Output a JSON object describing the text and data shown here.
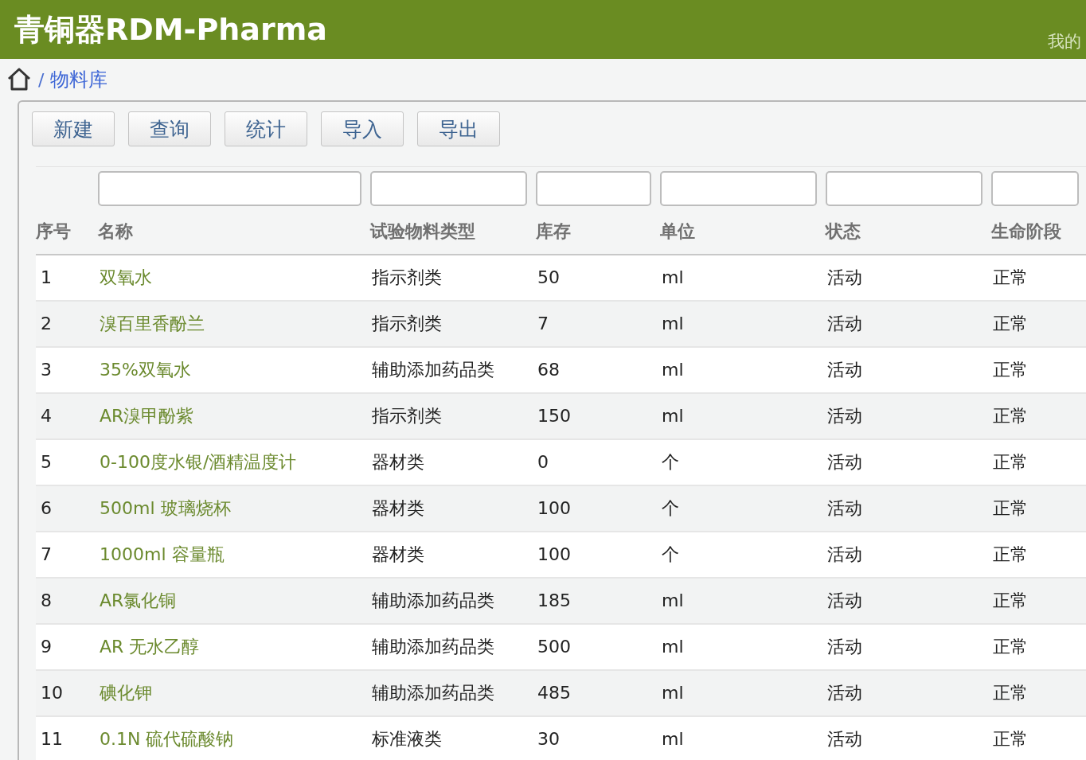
{
  "header": {
    "title": "青铜器RDM-Pharma",
    "user_menu": "我的"
  },
  "breadcrumb": {
    "separator": "/",
    "current": "物料库"
  },
  "toolbar": [
    "新建",
    "查询",
    "统计",
    "导入",
    "导出"
  ],
  "table": {
    "columns": [
      {
        "label": "序号",
        "filter": false
      },
      {
        "label": "名称",
        "filter": true
      },
      {
        "label": "试验物料类型",
        "filter": true
      },
      {
        "label": "库存",
        "filter": true
      },
      {
        "label": "单位",
        "filter": true
      },
      {
        "label": "状态",
        "filter": true
      },
      {
        "label": "生命阶段",
        "filter": true
      }
    ],
    "rows": [
      [
        "1",
        "双氧水",
        "指示剂类",
        "50",
        "ml",
        "活动",
        "正常"
      ],
      [
        "2",
        "溴百里香酚兰",
        "指示剂类",
        "7",
        "ml",
        "活动",
        "正常"
      ],
      [
        "3",
        "35%双氧水",
        "辅助添加药品类",
        "68",
        "ml",
        "活动",
        "正常"
      ],
      [
        "4",
        "AR溴甲酚紫",
        "指示剂类",
        "150",
        "ml",
        "活动",
        "正常"
      ],
      [
        "5",
        "0-100度水银/酒精温度计",
        "器材类",
        "0",
        "个",
        "活动",
        "正常"
      ],
      [
        "6",
        "500ml 玻璃烧杯",
        "器材类",
        "100",
        "个",
        "活动",
        "正常"
      ],
      [
        "7",
        "1000ml 容量瓶",
        "器材类",
        "100",
        "个",
        "活动",
        "正常"
      ],
      [
        "8",
        "AR氯化铜",
        "辅助添加药品类",
        "185",
        "ml",
        "活动",
        "正常"
      ],
      [
        "9",
        "AR 无水乙醇",
        "辅助添加药品类",
        "500",
        "ml",
        "活动",
        "正常"
      ],
      [
        "10",
        "碘化钾",
        "辅助添加药品类",
        "485",
        "ml",
        "活动",
        "正常"
      ],
      [
        "11",
        "0.1N 硫代硫酸钠",
        "标准液类",
        "30",
        "ml",
        "活动",
        "正常"
      ]
    ]
  }
}
